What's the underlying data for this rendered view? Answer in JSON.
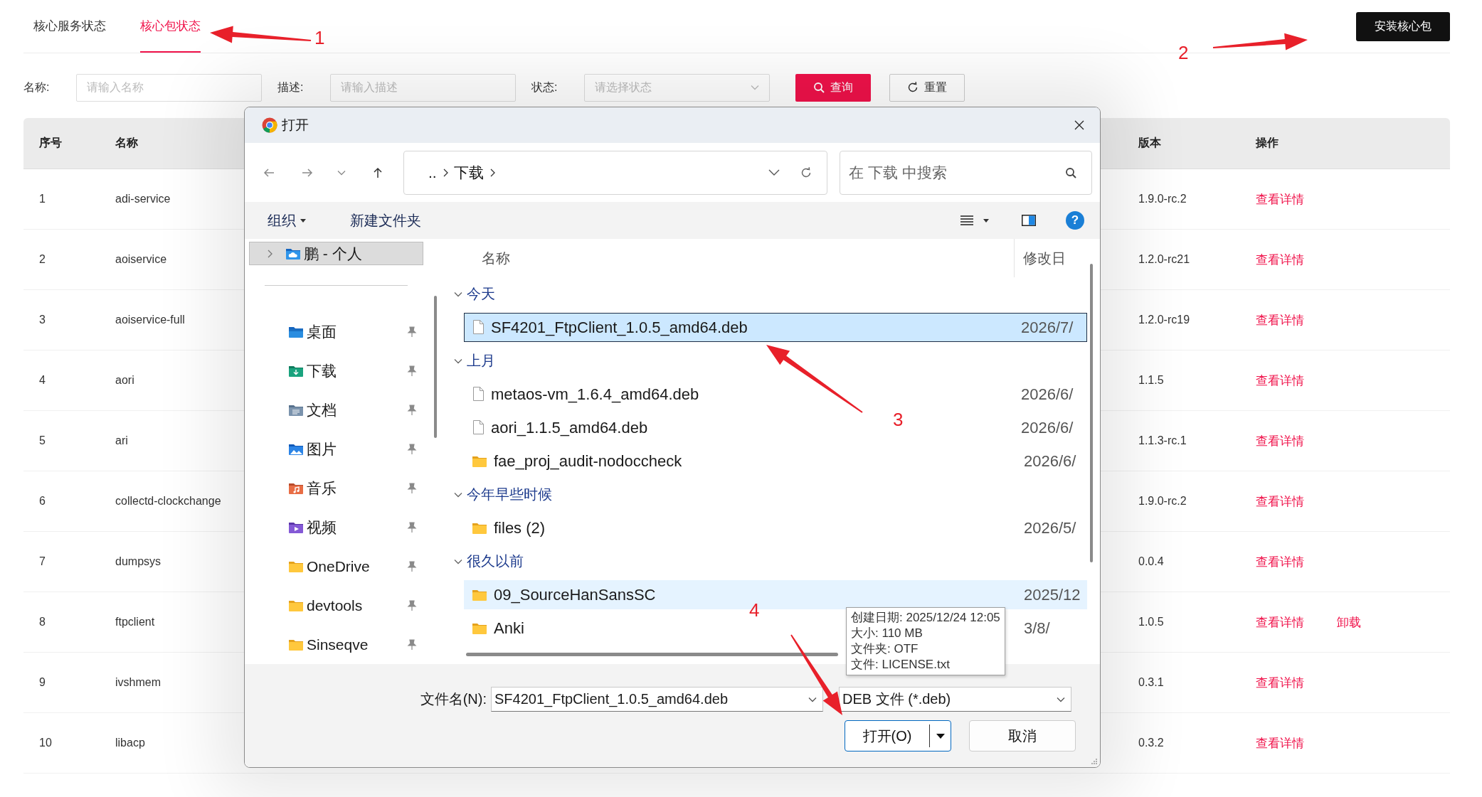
{
  "tabs": [
    {
      "label": "核心服务状态",
      "selected": false
    },
    {
      "label": "核心包状态",
      "selected": true
    }
  ],
  "install_button": {
    "label": "安装核心包"
  },
  "filters": [
    {
      "label": "名称:",
      "placeholder": "请输入名称",
      "kind": "input"
    },
    {
      "label": "描述:",
      "placeholder": "请输入描述",
      "kind": "input"
    },
    {
      "label": "状态:",
      "placeholder": "请选择状态",
      "kind": "select"
    }
  ],
  "filter_buttons": [
    {
      "label": "查询",
      "kind": "primary"
    },
    {
      "label": "重置",
      "kind": "reset"
    }
  ],
  "table": {
    "columns": [
      "序号",
      "名称",
      "版本",
      "操作"
    ],
    "rows": [
      {
        "cells": [
          "1",
          "adi-service",
          "1.9.0-rc.2"
        ],
        "actions": [
          "查看详情"
        ]
      },
      {
        "cells": [
          "2",
          "aoiservice",
          "1.2.0-rc21"
        ],
        "actions": [
          "查看详情"
        ]
      },
      {
        "cells": [
          "3",
          "aoiservice-full",
          "1.2.0-rc19"
        ],
        "actions": [
          "查看详情"
        ]
      },
      {
        "cells": [
          "4",
          "aori",
          "1.1.5"
        ],
        "actions": [
          "查看详情"
        ]
      },
      {
        "cells": [
          "5",
          "ari",
          "1.1.3-rc.1"
        ],
        "actions": [
          "查看详情"
        ]
      },
      {
        "cells": [
          "6",
          "collectd-clockchange",
          "1.9.0-rc.2"
        ],
        "actions": [
          "查看详情"
        ]
      },
      {
        "cells": [
          "7",
          "dumpsys",
          "0.0.4"
        ],
        "actions": [
          "查看详情"
        ]
      },
      {
        "cells": [
          "8",
          "ftpclient",
          "1.0.5"
        ],
        "actions": [
          "查看详情",
          "卸载"
        ]
      },
      {
        "cells": [
          "9",
          "ivshmem",
          "0.3.1"
        ],
        "actions": [
          "查看详情"
        ]
      },
      {
        "cells": [
          "10",
          "libacp",
          "0.3.2"
        ],
        "actions": [
          "查看详情"
        ]
      }
    ]
  },
  "dialog": {
    "title": "打开",
    "breadcrumbs": [
      "..",
      "下载"
    ],
    "search": {
      "placeholder": "在 下载 中搜索"
    },
    "toolbar": [
      {
        "label": "组织",
        "dropdown": true
      },
      {
        "label": "新建文件夹",
        "dropdown": false
      }
    ],
    "help_button": "?",
    "sidebar": {
      "root": {
        "label": "鹏 - 个人",
        "selected": true,
        "expanded": false
      },
      "quick_access": [
        {
          "label": "桌面",
          "kind": "desktop",
          "pinned": true
        },
        {
          "label": "下载",
          "kind": "downloads",
          "pinned": true
        },
        {
          "label": "文档",
          "kind": "documents",
          "pinned": true
        },
        {
          "label": "图片",
          "kind": "pictures",
          "pinned": true
        },
        {
          "label": "音乐",
          "kind": "music",
          "pinned": true
        },
        {
          "label": "视频",
          "kind": "videos",
          "pinned": true
        },
        {
          "label": "OneDrive",
          "kind": "folder",
          "pinned": true
        },
        {
          "label": "devtools",
          "kind": "folder",
          "pinned": true
        },
        {
          "label": "Sinseqve",
          "kind": "folder",
          "pinned": true
        }
      ]
    },
    "list_columns": [
      "名称",
      "修改日"
    ],
    "groups": [
      {
        "label": "今天",
        "expanded": true,
        "items": [
          {
            "name": "SF4201_FtpClient_1.0.5_amd64.deb",
            "date": "2026/7/",
            "kind": "file",
            "selected": true,
            "hovered": false
          }
        ]
      },
      {
        "label": "上月",
        "expanded": true,
        "items": [
          {
            "name": "metaos-vm_1.6.4_amd64.deb",
            "date": "2026/6/",
            "kind": "file",
            "selected": false,
            "hovered": false
          },
          {
            "name": "aori_1.1.5_amd64.deb",
            "date": "2026/6/",
            "kind": "file",
            "selected": false,
            "hovered": false
          },
          {
            "name": "fae_proj_audit-nodoccheck",
            "date": "2026/6/",
            "kind": "folder",
            "selected": false,
            "hovered": false
          }
        ]
      },
      {
        "label": "今年早些时候",
        "expanded": true,
        "items": [
          {
            "name": "files (2)",
            "date": "2026/5/",
            "kind": "folder",
            "selected": false,
            "hovered": false
          }
        ]
      },
      {
        "label": "很久以前",
        "expanded": true,
        "items": [
          {
            "name": "09_SourceHanSansSC",
            "date": "2025/12",
            "kind": "folder",
            "selected": false,
            "hovered": true
          },
          {
            "name": "Anki",
            "date": "3/8/",
            "kind": "folder",
            "selected": false,
            "hovered": false
          }
        ]
      }
    ],
    "tooltip": [
      "创建日期: 2025/12/24 12:05",
      "大小: 110 MB",
      "文件夹: OTF",
      "文件: LICENSE.txt"
    ],
    "filename": {
      "label": "文件名(N):",
      "value": "SF4201_FtpClient_1.0.5_amd64.deb"
    },
    "file_type": "DEB 文件 (*.deb)",
    "buttons": [
      {
        "label": "打开(O)",
        "kind": "split"
      },
      {
        "label": "取消",
        "kind": "plain"
      }
    ]
  },
  "annotations": [
    {
      "label": "1"
    },
    {
      "label": "2"
    },
    {
      "label": "3"
    },
    {
      "label": "4"
    }
  ]
}
